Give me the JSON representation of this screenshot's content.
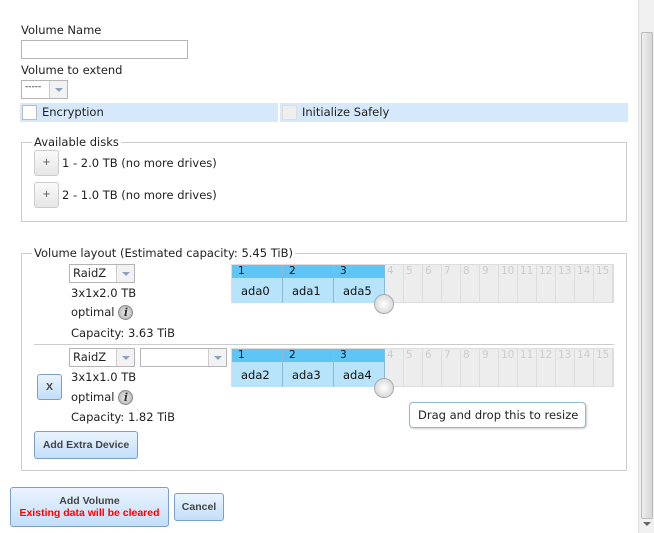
{
  "form": {
    "volume_name_label": "Volume Name",
    "volume_name_value": "",
    "extend_label": "Volume to extend",
    "extend_value": "-----",
    "encryption_label": "Encryption",
    "init_safely_label": "Initialize Safely"
  },
  "available": {
    "legend": "Available disks",
    "disks": [
      {
        "label": "1 - 2.0 TB (no more drives)",
        "button": "+"
      },
      {
        "label": "2 - 1.0 TB (no more drives)",
        "button": "+"
      }
    ]
  },
  "layout": {
    "legend": "Volume layout (Estimated capacity: 5.45 TiB)",
    "vdevs": [
      {
        "type": "RaidZ",
        "size": "3x1x2.0 TB",
        "status": "optimal",
        "capacity": "Capacity: 3.63 TiB",
        "disks": [
          "ada0",
          "ada1",
          "ada5"
        ]
      },
      {
        "type": "RaidZ",
        "second_select": "",
        "size": "3x1x1.0 TB",
        "status": "optimal",
        "capacity": "Capacity: 1.82 TiB",
        "disks": [
          "ada2",
          "ada3",
          "ada4"
        ],
        "remove": "X"
      }
    ],
    "columns": [
      "1",
      "2",
      "3",
      "4",
      "5",
      "6",
      "7",
      "8",
      "9",
      "10",
      "11",
      "12",
      "13",
      "14",
      "15"
    ],
    "tooltip": "Drag and drop this to resize",
    "info_glyph": "i",
    "add_extra": "Add Extra Device"
  },
  "actions": {
    "add_volume": "Add Volume",
    "add_warning": "Existing data will be cleared",
    "cancel": "Cancel"
  },
  "colors": {
    "warning": "#ff0000",
    "selected_header": "#5ec5f6",
    "selected_cell": "#b7e3fb"
  }
}
